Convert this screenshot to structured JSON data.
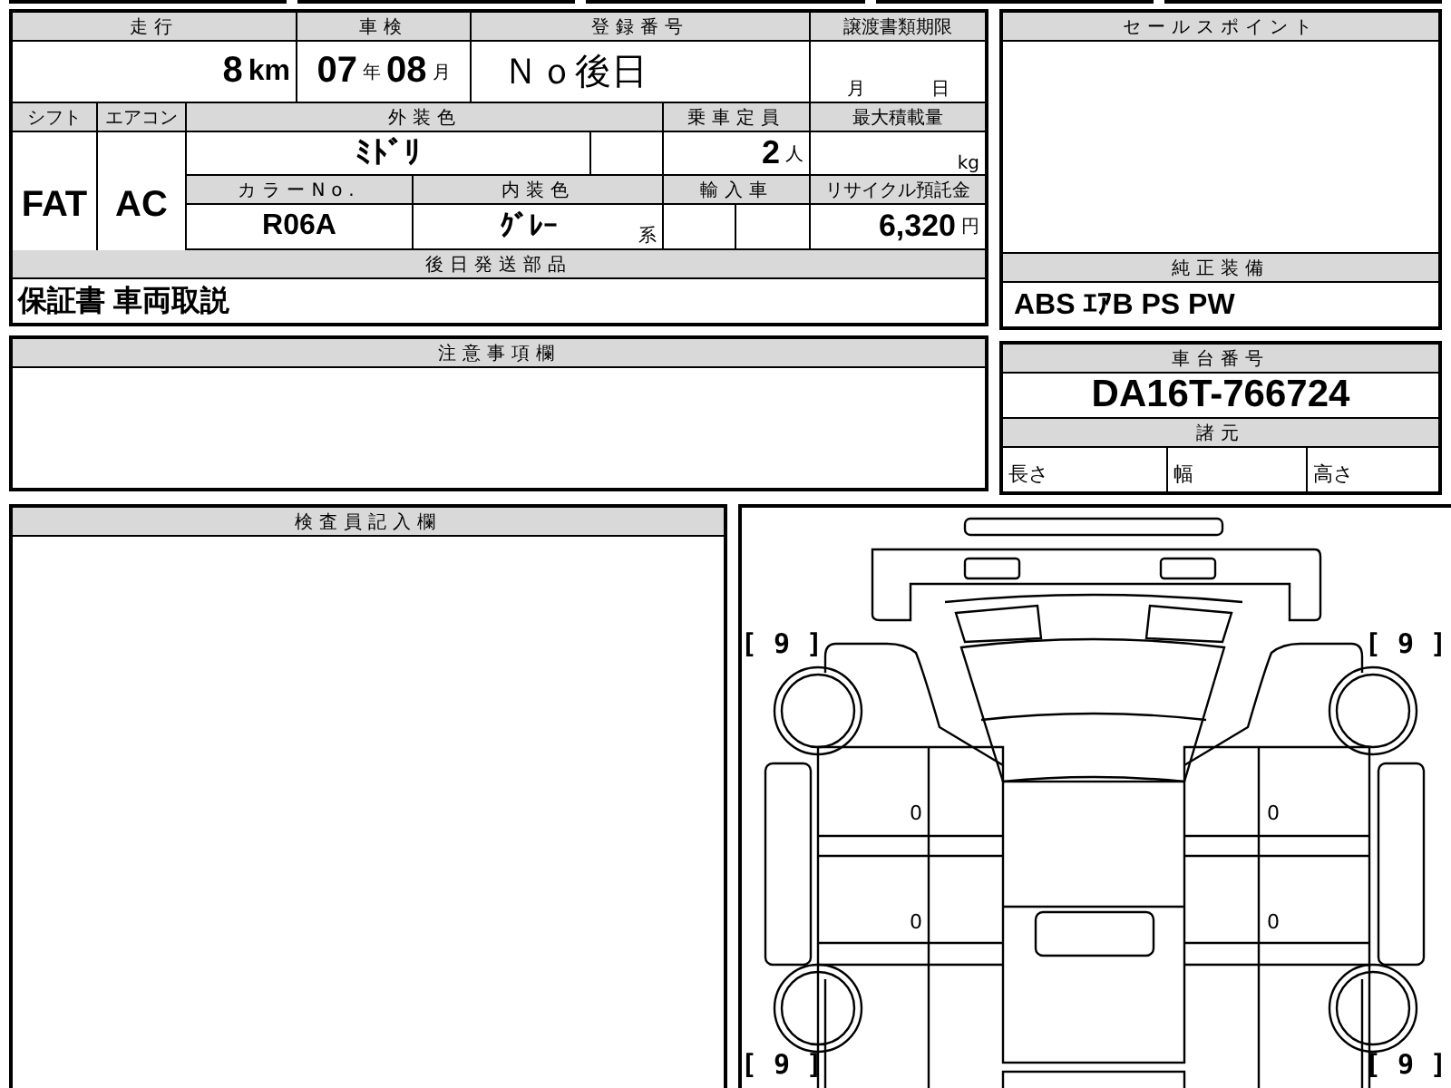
{
  "main_table": {
    "mileage": {
      "label": "走行",
      "value": "8",
      "unit": "km"
    },
    "inspection": {
      "label": "車検",
      "year": "07",
      "year_unit": "年",
      "month": "08",
      "month_unit": "月"
    },
    "registration": {
      "label": "登録番号",
      "value": "Ｎｏ後日"
    },
    "transfer_deadline": {
      "label": "譲渡書類期限",
      "month_unit": "月",
      "day_unit": "日"
    },
    "shift": {
      "label": "シフト",
      "value": "FAT"
    },
    "aircon": {
      "label": "エアコン",
      "value": "AC"
    },
    "exterior_color": {
      "label": "外装色",
      "value": "ﾐﾄﾞﾘ"
    },
    "capacity": {
      "label": "乗車定員",
      "value": "2",
      "unit": "人"
    },
    "max_load": {
      "label": "最大積載量",
      "unit": "kg"
    },
    "color_no": {
      "label": "カラーNo.",
      "value": "R06A"
    },
    "interior_color": {
      "label": "内装色",
      "value": "ｸﾞﾚｰ",
      "suffix": "系"
    },
    "imported": {
      "label": "輸入車"
    },
    "recycling_fee": {
      "label": "リサイクル預託金",
      "value": "6,320",
      "unit": "円"
    },
    "later_parts": {
      "label": "後日発送部品",
      "value": "保証書 車両取説"
    }
  },
  "sales_point": {
    "label": "セールスポイント"
  },
  "standard_equipment": {
    "label": "純正装備",
    "value": "ABS ｴｱB PS PW"
  },
  "chassis": {
    "label": "車台番号",
    "value": "DA16T-766724"
  },
  "specs": {
    "label": "諸元",
    "items": [
      "長さ",
      "幅",
      "高さ"
    ]
  },
  "notes": {
    "label": "注意事項欄"
  },
  "inspector": {
    "label": "検査員記入欄"
  },
  "diagram": {
    "corner_marks": [
      "[ 9 ]",
      "[ 9 ]",
      "[ 9 ]",
      "[ 9 ]"
    ],
    "door_marks": [
      "0",
      "0",
      "0",
      "0"
    ]
  }
}
